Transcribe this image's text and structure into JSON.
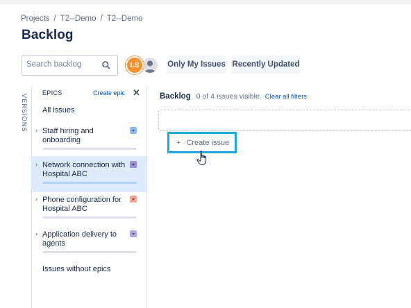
{
  "breadcrumbs": [
    "Projects",
    "T2--Demo",
    "T2--Demo"
  ],
  "breadcrumb_separator": "/",
  "page_title": "Backlog",
  "search": {
    "placeholder": "Search backlog",
    "icon": "search-icon"
  },
  "avatars": [
    {
      "initials": "LS",
      "color": "#f79232"
    },
    {
      "icon": "user-icon",
      "color": "#dfe1e6"
    }
  ],
  "quick_filters": [
    "Only My Issues",
    "Recently Updated"
  ],
  "sidebar": {
    "versions_label": "VERSIONS",
    "epics_label": "EPICS",
    "create_epic": "Create epic",
    "close_icon": "close-icon",
    "all_issues": "All issues",
    "epics": [
      {
        "title": "Staff hiring and onboarding",
        "color": "#8fb8f6",
        "selected": false,
        "progress": 0
      },
      {
        "title": "Network connection with Hospital ABC",
        "color": "#998dd9",
        "selected": true,
        "progress": 0
      },
      {
        "title": "Phone configuration for Hospital ABC",
        "color": "#f6a393",
        "selected": false,
        "progress": 0
      },
      {
        "title": "Application delivery to agents",
        "color": "#b0a6e6",
        "selected": false,
        "progress": 0
      }
    ],
    "issues_without_epics": "Issues without epics"
  },
  "backlog": {
    "heading": "Backlog",
    "count_text": "0 of 4 issues visible",
    "clear_filters": "Clear all filters",
    "create_issue": "Create issue",
    "create_issue_plus": "+"
  },
  "colors": {
    "accent": "#0052cc",
    "highlight_border": "#1fa7e1",
    "selected_bg": "#deebff"
  }
}
